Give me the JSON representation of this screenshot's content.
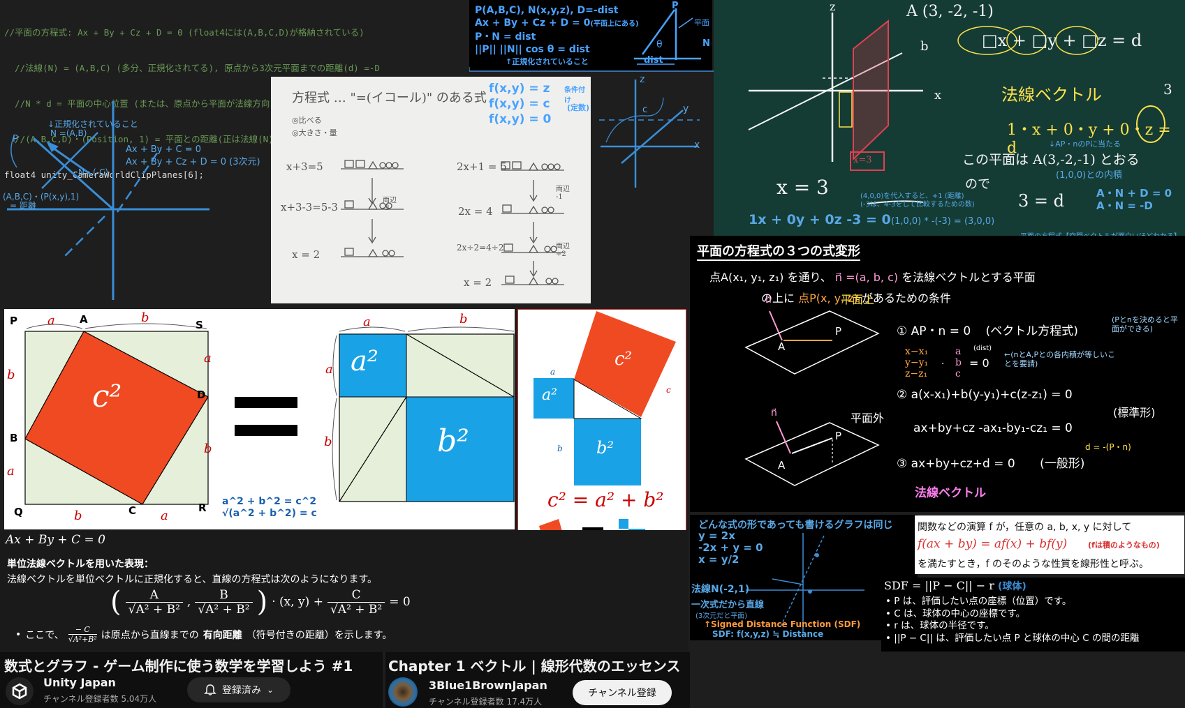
{
  "code_block": {
    "lines": [
      "//平面の方程式: Ax + By + Cz + D = 0 (float4には(A,B,C,D)が格納されている)",
      "  //法線(N) = (A,B,C) (多分、正規化されてる), 原点から3次元平面までの距離(d) =-D",
      "  //N * d = 平面の中心位置 (または、原点から平面が法線方向にどのくらいオフセットされているか)",
      "  //(A,B,C,D)・(Position, 1) = 平面との距離(正は法線(N)側)",
      "float4 unity_CameraWorldClipPlanes[6];"
    ]
  },
  "plane_dist_note": {
    "line1": "P(A,B,C), N(x,y,z), D=-dist",
    "line2": "Ax + By + Cz + D = 0",
    "line2_small": "(平面上にある)",
    "line3": "P・N = dist",
    "line4": "||P|| ||N|| cos θ = dist",
    "line5": "↑正規化されていること",
    "label_P": "P",
    "label_N": "N",
    "label_theta": "θ",
    "label_dist": "dist",
    "label_plane": "平面"
  },
  "axes_sketch": {
    "note1": "↓正規化されていること",
    "note2": "N =(A,B)",
    "label_P": "P",
    "label_Nneg": "N・(-C)",
    "eq1": "Ax + By + C = 0",
    "eq2": "Ax + By + Cz + D = 0 (3次元)",
    "dot": "(A,B,C)・(P(x,y),1)",
    "dot2": "= 距離"
  },
  "paper_note": {
    "title": "方程式 … \"=(イコール)\" のある式",
    "bullet1": "◎比べる",
    "bullet2": "◎大きさ・量",
    "left_eqs": [
      "x+3=5",
      "x+3-3=5-3",
      "x = 2"
    ],
    "left_side": "両辺 -3",
    "right_eqs": [
      "2x+1 = 5",
      "2x = 4",
      "2x÷2=4÷2",
      "x = 2"
    ],
    "right_side1": "両辺 -1",
    "right_side2": "両辺 ÷2",
    "overlay": [
      "f(x,y) = z",
      "f(x,y) = c",
      "f(x,y) = 0"
    ],
    "overlay_note1": "条件付け",
    "overlay_note2": "(定数)"
  },
  "small_axes": {
    "label_z": "z",
    "label_y": "y",
    "label_x": "x",
    "label_c": "c"
  },
  "chalkboard": {
    "point": "A (3, -2, -1)",
    "eq_boxed": "□x + □y + □z = d",
    "normal": "法線ベクトル",
    "num3": "3",
    "eq_dot": "1・x + 0・y + 0・z = d",
    "note_ap": "↓AP・nのPに当たる",
    "sentence": "この平面は A(3,-2,-1) とおる",
    "so": "ので",
    "inner": "(1,0,0)との内積",
    "x3_left": "x = 3",
    "x3_box": "x=3",
    "b_label": "b",
    "x_label": "x",
    "z_label": "z",
    "sub_note1": "(4,0,0)を代入すると、+1 (距離)",
    "sub_note2": "(-3は、4-3をして比較するための数)",
    "eq_final": "1x + 0y + 0z -3 = 0",
    "eq_final_note": "(1,0,0) * -(-3) = (3,0,0)",
    "eq3d": "3 = d",
    "an1": "A・N + D = 0",
    "an2": "A・N = -D",
    "source": "平面の方程式【空間ベクトルが面白いほどわかる】"
  },
  "plane_forms": {
    "title": "平面の方程式の３つの式変形",
    "intro1": "点A(x₁, y₁, z₁) を通り、",
    "intro_n": "n⃗ =(a, b, c)",
    "intro2": "を法線ベクトルとする平面",
    "intro3": "の上に",
    "intro_p": "点P(x, y, z)",
    "intro4": "があるための条件",
    "on_plane": "平面上",
    "off_plane": "平面外",
    "label_n": "n⃗",
    "label_A": "A",
    "label_P": "P",
    "f1_num": "①",
    "f1": "AP・n = 0",
    "f1_name": "(ベクトル方程式)",
    "f1_note": "(Pとnを決めると平面ができる)",
    "matrix_note": "←(nとA,Pとの各内積が等しいことを要請)",
    "dist_small": "(dist)",
    "f2_num": "②",
    "f2": "a(x-x₁)+b(y-y₁)+c(z-z₁) = 0",
    "f2_name": "(標準形)",
    "f2b": "ax+by+cz -ax₁-by₁-cz₁ = 0",
    "d_note": "d = -(P・n)",
    "f3_num": "③",
    "f3": "ax+by+cz+d = 0",
    "f3_name": "(一般形)",
    "normal_vec": "法線ベクトル"
  },
  "pythagoras_left": {
    "corner_labels": [
      "P",
      "A",
      "S",
      "D",
      "R",
      "C",
      "Q",
      "B"
    ],
    "a": "a",
    "b": "b",
    "c2": "c²",
    "a2": "a²",
    "b2": "b²",
    "note1": "a^2 + b^2 = c^2",
    "note2": "√(a^2 + b^2) = c"
  },
  "pythagoras_right": {
    "a2": "a²",
    "b2": "b²",
    "c2": "c²",
    "a": "a",
    "b": "b",
    "c": "c",
    "formula": "c² = a² + b²"
  },
  "line_normal": {
    "heading": "Ax + By + C = 0",
    "subtitle": "単位法線ベクトルを用いた表現：",
    "desc": "法線ベクトルを単位ベクトルに正規化すると、直線の方程式は次のようになります。",
    "formula_A": "A",
    "formula_B": "B",
    "formula_root": "√A² + B²",
    "formula_mid": "· (x, y) +",
    "formula_C": "C",
    "formula_end": "= 0",
    "bullet_pre": "ここで、",
    "bullet_frac_num": "− C",
    "bullet_frac_den": "√A²+B²",
    "bullet_mid": "は原点から直線までの",
    "bullet_bold": "有向距離",
    "bullet_post": "（符号付きの距離）を示します。"
  },
  "graph_note": {
    "title": "どんな式の形であっても書けるグラフは同じ",
    "eq1": "y = 2x",
    "eq2": "-2x + y = 0",
    "eq3": "x = y/2",
    "normal": "法線N(-2,1)",
    "linear": "一次式だから直線",
    "linear_sub": "(3次元だと平面)",
    "sdf": "↑Signed Distance Function (SDF)",
    "sdf2": "SDF: f(x,y,z) ≒ Distance"
  },
  "linearity": {
    "line1": "関数などの演算 f が，任意の a, b, x, y に対して",
    "line2": "f(ax + by) = af(x) + bf(y)",
    "line2_note": "(fは積のようなもの)",
    "line3": "を満たすとき，f のそのような性質を線形性と呼ぶ。"
  },
  "sdf_box": {
    "title": "SDF = ||P − C|| − r",
    "title_note": "(球体)",
    "items": [
      "P は、評価したい点の座標（位置）です。",
      "C は、球体の中心の座標です。",
      "r は、球体の半径です。",
      "||P − C|| は、評価したい点 P と球体の中心 C の間の距離"
    ]
  },
  "video_left": {
    "title": "数式とグラフ - ゲーム制作に使う数学を学習しよう #1",
    "channel": "Unity Japan",
    "subs": "チャンネル登録者数 5.04万人",
    "button": "登録済み"
  },
  "video_right": {
    "title": "Chapter 1 ベクトル | 線形代数のエッセンス",
    "channel": "3Blue1BrownJapan",
    "subs": "チャンネル登録者数 17.4万人",
    "button": "チャンネル登録"
  },
  "colors": {
    "blue_note": "#4aa3ff",
    "chalk_bg": "#143c35",
    "red_square": "#f04a23",
    "blue_square": "#1aa2e6",
    "green_bg": "#e5efd9"
  }
}
